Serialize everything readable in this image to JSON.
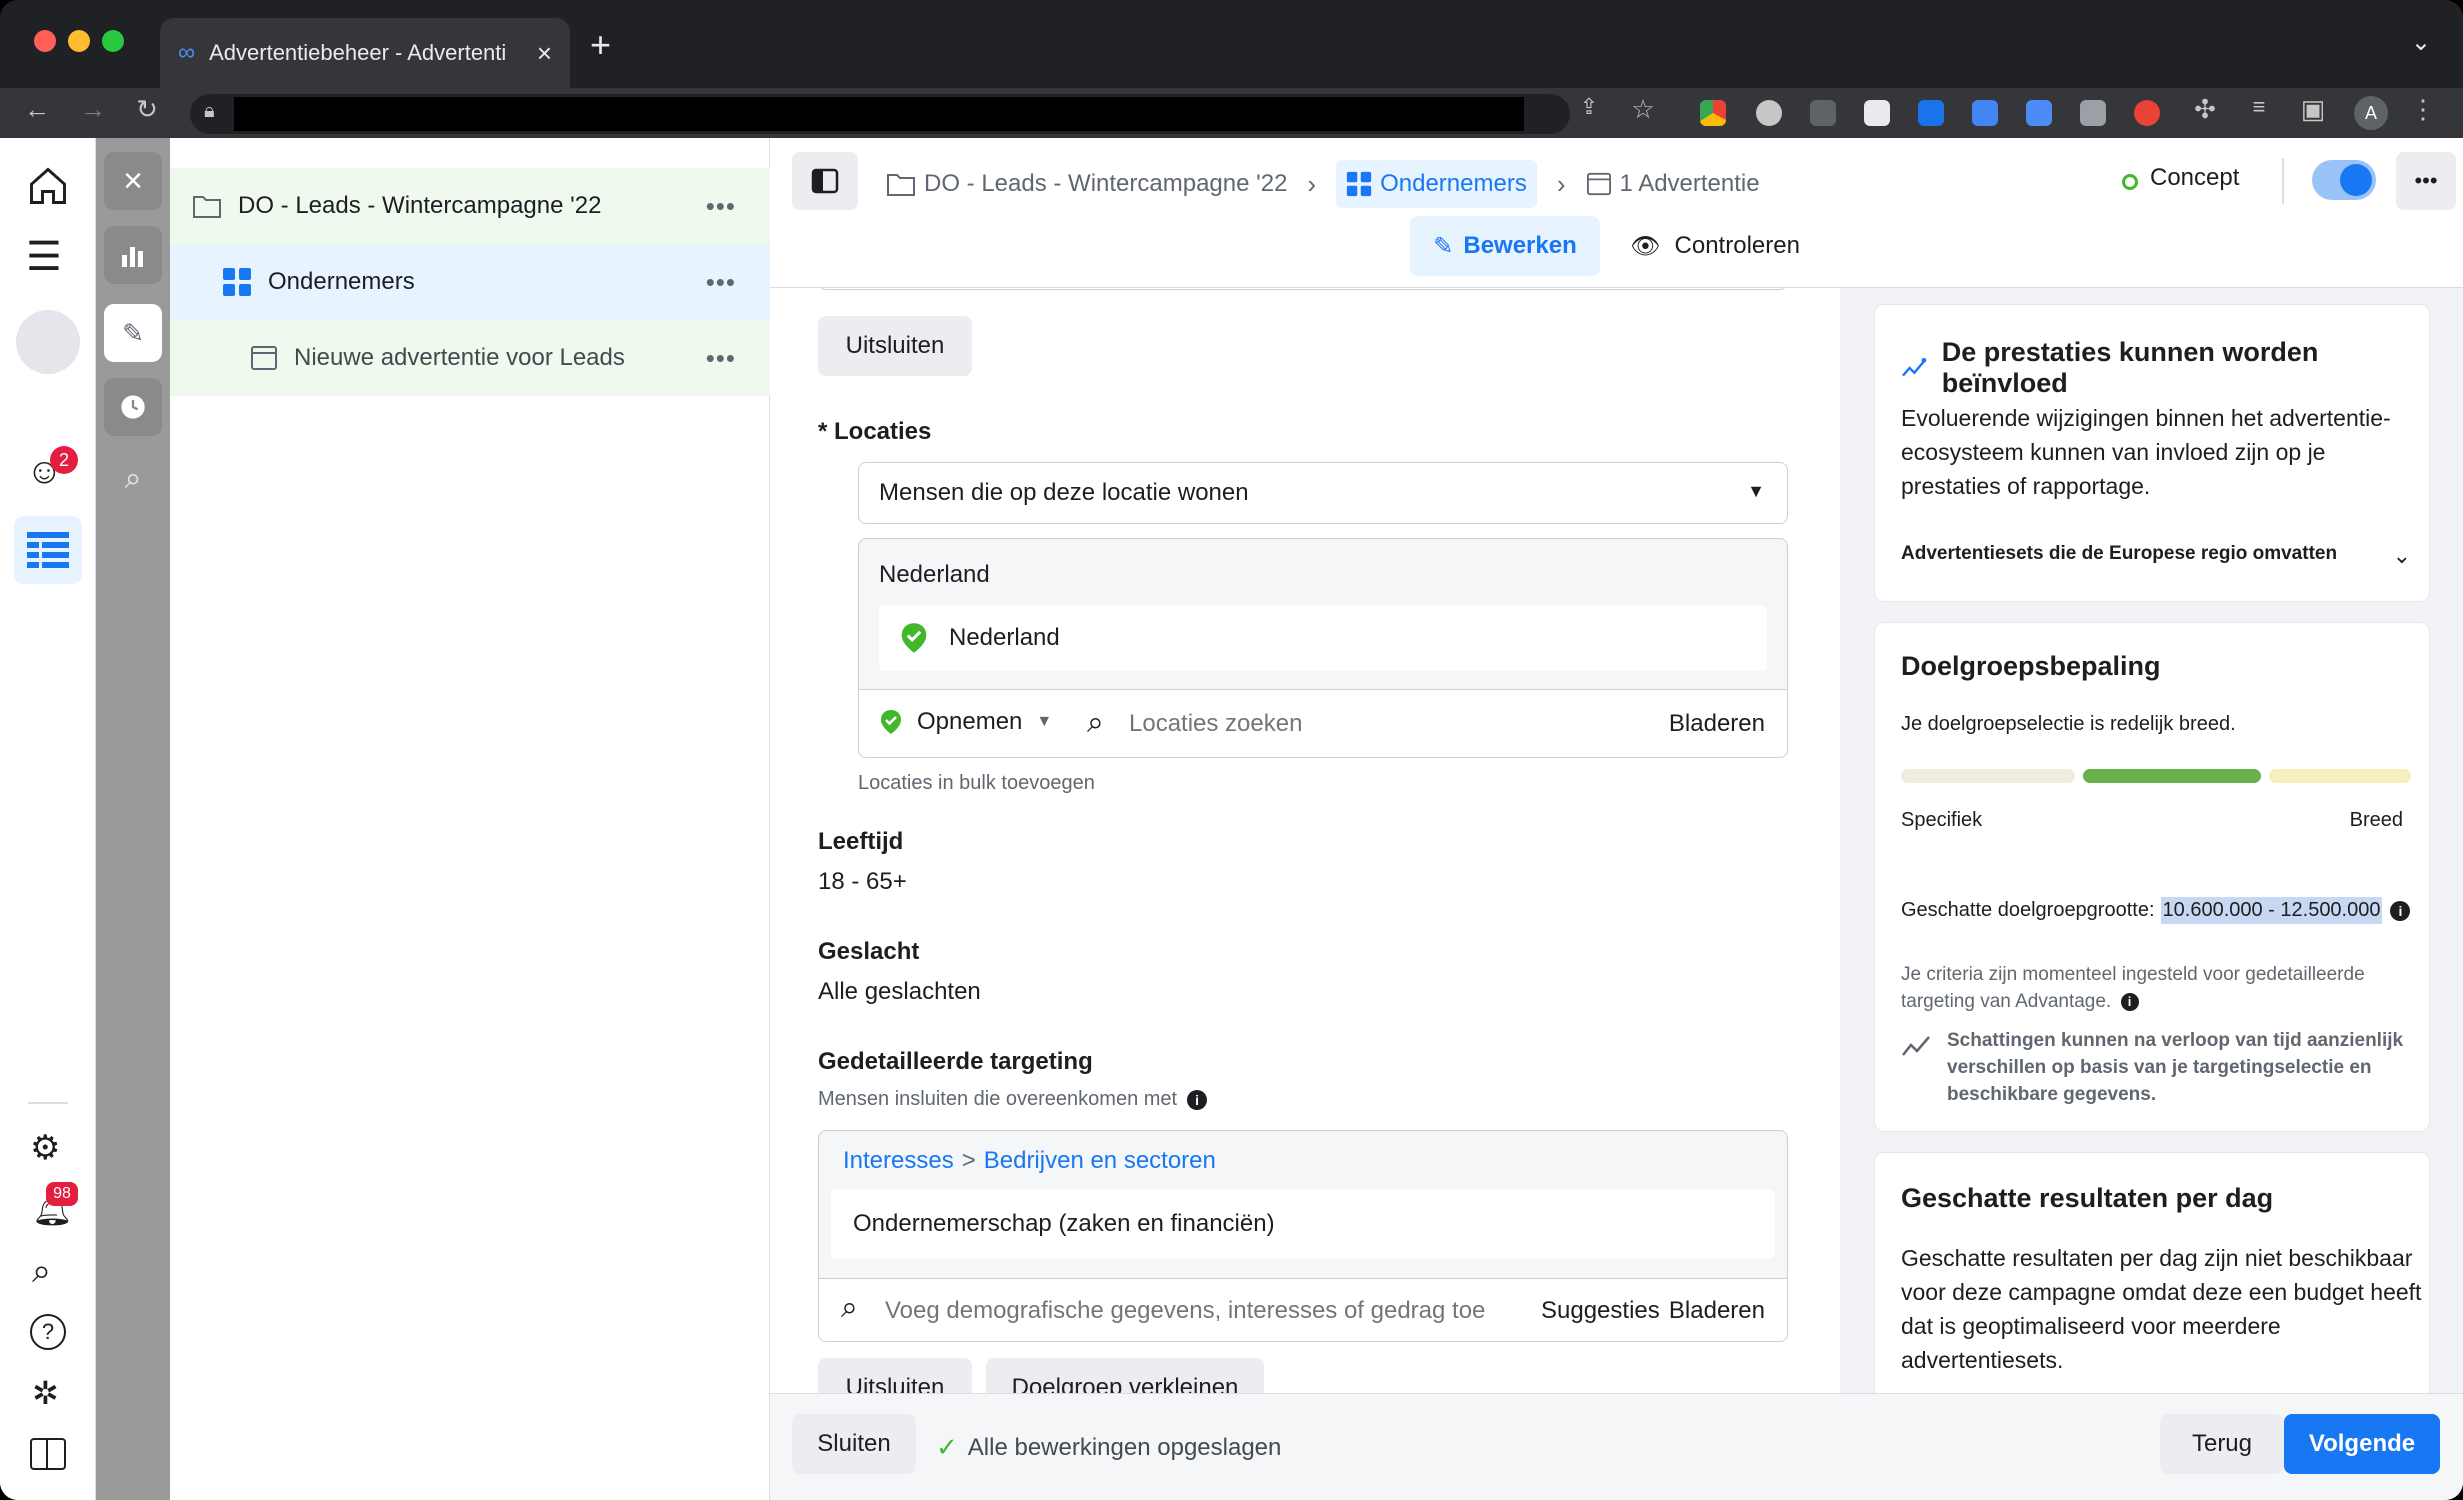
{
  "browser": {
    "tab_title": "Advertentiebeheer - Advertenti",
    "new_tab": "+",
    "profile_initial": "A"
  },
  "tree": {
    "items": [
      {
        "label": "DO - Leads - Wintercampagne '22",
        "more": "•••"
      },
      {
        "label": "Ondernemers",
        "more": "•••"
      },
      {
        "label": "Nieuwe advertentie voor Leads",
        "more": "•••"
      }
    ]
  },
  "rail": {
    "notification_badge": "2",
    "alerts_badge": "98"
  },
  "header": {
    "crumb_campaign": "DO - Leads - Wintercampagne '22",
    "crumb_adset": "Ondernemers",
    "crumb_ad": "1 Advertentie",
    "status": "Concept",
    "edit_tab": "Bewerken",
    "review_tab": "Controleren",
    "more": "•••"
  },
  "form": {
    "exclude_top": "Uitsluiten",
    "locations_label": "* Locaties",
    "locations_select": "Mensen die op deze locatie wonen",
    "locations_group": "Nederland",
    "location_item": "Nederland",
    "include_select": "Opnemen",
    "location_search_placeholder": "Locaties zoeken",
    "browse": "Bladeren",
    "bulk_add": "Locaties in bulk toevoegen",
    "age_label": "Leeftijd",
    "age_value": "18 - 65+",
    "gender_label": "Geslacht",
    "gender_value": "Alle geslachten",
    "detailed_label": "Gedetailleerde targeting",
    "detailed_sub": "Mensen insluiten die overeenkomen met",
    "interests_link1": "Interesses",
    "interests_sep": ">",
    "interests_link2": "Bedrijven en sectoren",
    "interest_item": "Ondernemerschap (zaken en financiën)",
    "demo_placeholder": "Voeg demografische gegevens, interesses of gedrag toe",
    "suggestions": "Suggesties",
    "browse2": "Bladeren",
    "exclude_bottom": "Uitsluiten",
    "narrow": "Doelgroep verkleinen"
  },
  "side": {
    "perf_title": "De prestaties kunnen worden beïnvloed",
    "perf_body": "Evoluerende wijzigingen binnen het advertentie-ecosysteem kunnen van invloed zijn op je prestaties of rapportage.",
    "perf_link": "Advertentiesets die de Europese regio omvatten",
    "aud_title": "Doelgroepsbepaling",
    "aud_sub": "Je doelgroepselectie is redelijk breed.",
    "aud_level": 0.5,
    "specific": "Specifiek",
    "broad": "Breed",
    "size_label": "Geschatte doelgroepgrootte:",
    "size_value": "10.600.000 - 12.500.000",
    "adv_note": "Je criteria zijn momenteel ingesteld voor gedetailleerde targeting van Advantage.",
    "estimate_note": "Schattingen kunnen na verloop van tijd aanzienlijk verschillen op basis van je targetingselectie en beschikbare gegevens.",
    "results_title": "Geschatte resultaten per dag",
    "results_body": "Geschatte resultaten per dag zijn niet beschikbaar voor deze campagne omdat deze een budget heeft dat is geoptimaliseerd voor meerdere advertentiesets."
  },
  "footer": {
    "close": "Sluiten",
    "saved": "Alle bewerkingen opgeslagen",
    "back": "Terug",
    "next": "Volgende"
  },
  "colors": {
    "accent": "#1877f2",
    "success": "#42b72a"
  }
}
